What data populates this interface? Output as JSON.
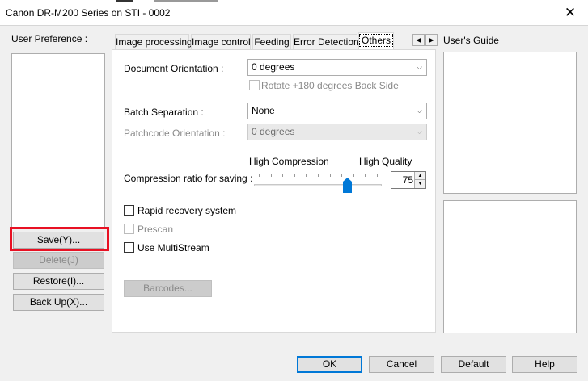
{
  "window": {
    "title": "Canon DR-M200 Series on STI - 0002",
    "close_symbol": "✕"
  },
  "user_preference": {
    "label": "User Preference :",
    "buttons": {
      "save": "Save(Y)...",
      "delete": "Delete(J)",
      "restore": "Restore(I)...",
      "backup": "Back Up(X)..."
    }
  },
  "tabs": [
    {
      "label": "Image processing",
      "active": false
    },
    {
      "label": "Image control",
      "active": false
    },
    {
      "label": "Feeding",
      "active": false
    },
    {
      "label": "Error Detection",
      "active": false
    },
    {
      "label": "Others",
      "active": true
    }
  ],
  "tab_scroll": {
    "left": "◀",
    "right": "▶"
  },
  "others": {
    "document_orientation": {
      "label": "Document Orientation :",
      "value": "0 degrees"
    },
    "rotate_back_side": {
      "label": "Rotate +180 degrees Back Side",
      "checked": false,
      "enabled": false
    },
    "batch_separation": {
      "label": "Batch Separation :",
      "value": "None"
    },
    "patchcode_orientation": {
      "label": "Patchcode Orientation :",
      "value": "0 degrees",
      "enabled": false
    },
    "compression": {
      "label": "Compression ratio for saving :",
      "low_label": "High Compression",
      "high_label": "High Quality",
      "value": "75",
      "slider_fraction": 0.75
    },
    "rapid_recovery": {
      "label": "Rapid recovery system",
      "checked": false
    },
    "prescan": {
      "label": "Prescan",
      "checked": false,
      "enabled": false
    },
    "use_multistream": {
      "label": "Use MultiStream",
      "checked": false
    },
    "barcodes_button": "Barcodes..."
  },
  "users_guide": {
    "label": "User's Guide"
  },
  "footer": {
    "ok": "OK",
    "cancel": "Cancel",
    "default": "Default",
    "help": "Help"
  },
  "colors": {
    "highlight": "#e81123",
    "slider_thumb": "#0078d7",
    "default_button_border": "#0078d7"
  }
}
